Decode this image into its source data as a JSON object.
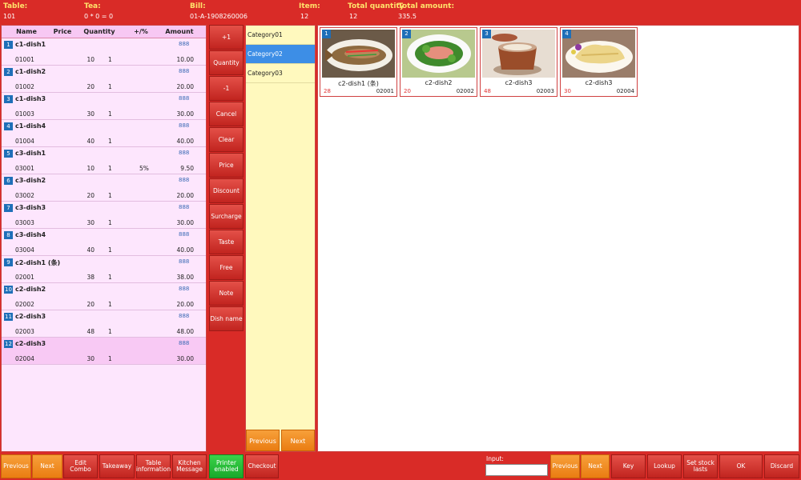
{
  "header": {
    "table_label": "Table:",
    "table_value": "101",
    "tea_label": "Tea:",
    "tea_value": "0 * 0 = 0",
    "bill_label": "Bill:",
    "bill_value": "01-A-1908260006",
    "item_label": "Item:",
    "item_value": "12",
    "total_quantity_label": "Total quantity",
    "total_quantity_value": "12",
    "total_amount_label": "Total amount:",
    "total_amount_value": "335.5"
  },
  "order": {
    "columns": [
      "Name",
      "Price",
      "Quantity",
      "+/%",
      "Amount"
    ],
    "rows": [
      {
        "num": "1",
        "name": "c1-dish1",
        "disc": "888",
        "code": "01001",
        "price": "10",
        "qty": "1",
        "pct": "",
        "amount": "10.00"
      },
      {
        "num": "2",
        "name": "c1-dish2",
        "disc": "888",
        "code": "01002",
        "price": "20",
        "qty": "1",
        "pct": "",
        "amount": "20.00"
      },
      {
        "num": "3",
        "name": "c1-dish3",
        "disc": "888",
        "code": "01003",
        "price": "30",
        "qty": "1",
        "pct": "",
        "amount": "30.00"
      },
      {
        "num": "4",
        "name": "c1-dish4",
        "disc": "888",
        "code": "01004",
        "price": "40",
        "qty": "1",
        "pct": "",
        "amount": "40.00"
      },
      {
        "num": "5",
        "name": "c3-dish1",
        "disc": "888",
        "code": "03001",
        "price": "10",
        "qty": "1",
        "pct": "5%",
        "amount": "9.50"
      },
      {
        "num": "6",
        "name": "c3-dish2",
        "disc": "888",
        "code": "03002",
        "price": "20",
        "qty": "1",
        "pct": "",
        "amount": "20.00"
      },
      {
        "num": "7",
        "name": "c3-dish3",
        "disc": "888",
        "code": "03003",
        "price": "30",
        "qty": "1",
        "pct": "",
        "amount": "30.00"
      },
      {
        "num": "8",
        "name": "c3-dish4",
        "disc": "888",
        "code": "03004",
        "price": "40",
        "qty": "1",
        "pct": "",
        "amount": "40.00"
      },
      {
        "num": "9",
        "name": "c2-dish1 (条)",
        "disc": "888",
        "code": "02001",
        "price": "38",
        "qty": "1",
        "pct": "",
        "amount": "38.00"
      },
      {
        "num": "10",
        "name": "c2-dish2",
        "disc": "888",
        "code": "02002",
        "price": "20",
        "qty": "1",
        "pct": "",
        "amount": "20.00"
      },
      {
        "num": "11",
        "name": "c2-dish3",
        "disc": "888",
        "code": "02003",
        "price": "48",
        "qty": "1",
        "pct": "",
        "amount": "48.00"
      },
      {
        "num": "12",
        "name": "c2-dish3",
        "disc": "888",
        "code": "02004",
        "price": "30",
        "qty": "1",
        "pct": "",
        "amount": "30.00"
      }
    ]
  },
  "functions": [
    "+1",
    "Quantity",
    "-1",
    "Cancel",
    "Clear",
    "Price",
    "Discount",
    "Surcharge",
    "Taste",
    "Free",
    "Note",
    "Dish name"
  ],
  "categories": [
    "Category01",
    "Category02",
    "Category03"
  ],
  "category_nav": {
    "previous": "Previous",
    "next": "Next"
  },
  "dishes": [
    {
      "idx": "1",
      "name": "c2-dish1 (条)",
      "qty": "28",
      "code": "02001"
    },
    {
      "idx": "2",
      "name": "c2-dish2",
      "qty": "20",
      "code": "02002"
    },
    {
      "idx": "3",
      "name": "c2-dish3",
      "qty": "48",
      "code": "02003"
    },
    {
      "idx": "4",
      "name": "c2-dish3",
      "qty": "30",
      "code": "02004"
    }
  ],
  "bottom": {
    "previous": "Previous",
    "next": "Next",
    "edit_combo": "Edit Combo",
    "takeaway": "Takeaway",
    "table_information": "Table information",
    "kitchen_message": "Kitchen Message",
    "printer_enabled": "Printer enabled",
    "checkout": "Checkout",
    "input_label": "Input:",
    "input_value": "",
    "previous2": "Previous",
    "next2": "Next",
    "key": "Key",
    "lookup": "Lookup",
    "set_stock_lasts": "Set stock lasts",
    "ok": "OK",
    "discard": "Discard"
  },
  "colors": {
    "primary_red": "#d92b27",
    "orange": "#ea7d12",
    "green": "#19a82b",
    "selected_blue": "#3d8ee6",
    "index_blue": "#1f6fb8"
  }
}
